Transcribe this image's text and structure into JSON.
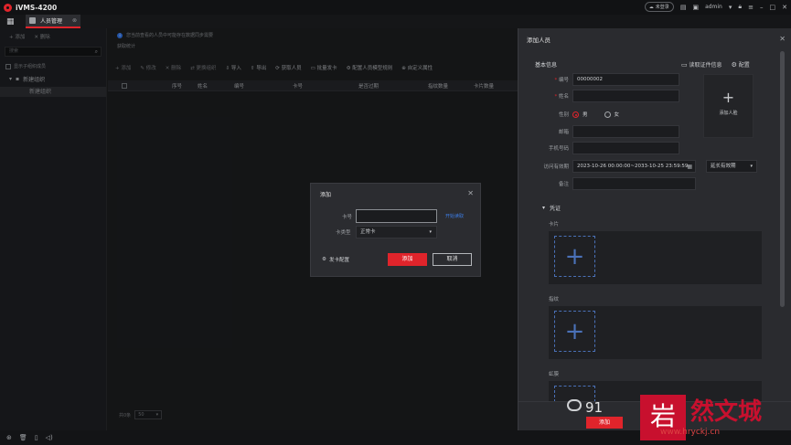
{
  "app": {
    "title": "iVMS-4200"
  },
  "titlebar": {
    "cloud_label": "未登录",
    "user": "admin"
  },
  "tab": {
    "label": "人员管理"
  },
  "left_panel": {
    "add_label": "添加",
    "delete_label": "删除",
    "search_placeholder": "搜索",
    "show_sub_label": "显示子组织成员",
    "tree_root": "新建组织",
    "tree_child": "新建组织"
  },
  "main": {
    "tip": "您当前查看的人员中可能存在数据同步需要",
    "stat": "获取统计",
    "toolbar": [
      "添加",
      "修改",
      "删除",
      "更换组织",
      "导入",
      "导出",
      "获取人员",
      "批量发卡",
      "配置人员模型规则",
      "自定义属性"
    ],
    "columns": [
      "序号",
      "姓名",
      "编号",
      "卡号",
      "是否过期",
      "指纹数量",
      "卡片数量"
    ],
    "pager_label": "共0条",
    "page_size": "50"
  },
  "drawer": {
    "title": "添加人员",
    "basic_section": "基本信息",
    "read_id_label": "读取证件信息",
    "config_label": "配置",
    "fields": {
      "id_label": "编号",
      "id_value": "00000002",
      "name_label": "姓名",
      "gender_label": "性别",
      "male": "男",
      "female": "女",
      "email_label": "邮箱",
      "phone_label": "手机号码",
      "validity_label": "访问有效期",
      "validity_value": "2023-10-26 00:00:00~2033-10-25 23:59:59",
      "validity_type": "延长有效期",
      "remark_label": "备注"
    },
    "add_face_label": "添加人脸",
    "credential_section": "凭证",
    "card_label": "卡片",
    "fingerprint_label": "指纹",
    "iris_label": "虹膜",
    "add_button": "添加"
  },
  "modal": {
    "title": "添加",
    "card_no_label": "卡号",
    "start_read": "开始读取",
    "card_type_label": "卡类型",
    "card_type_value": "正常卡",
    "issue_config": "发卡配置",
    "confirm": "添加",
    "cancel": "取消"
  },
  "watermark": {
    "number": "91",
    "seal_char": "岩",
    "text": "然文城",
    "url": "www.hryckj.cn"
  }
}
